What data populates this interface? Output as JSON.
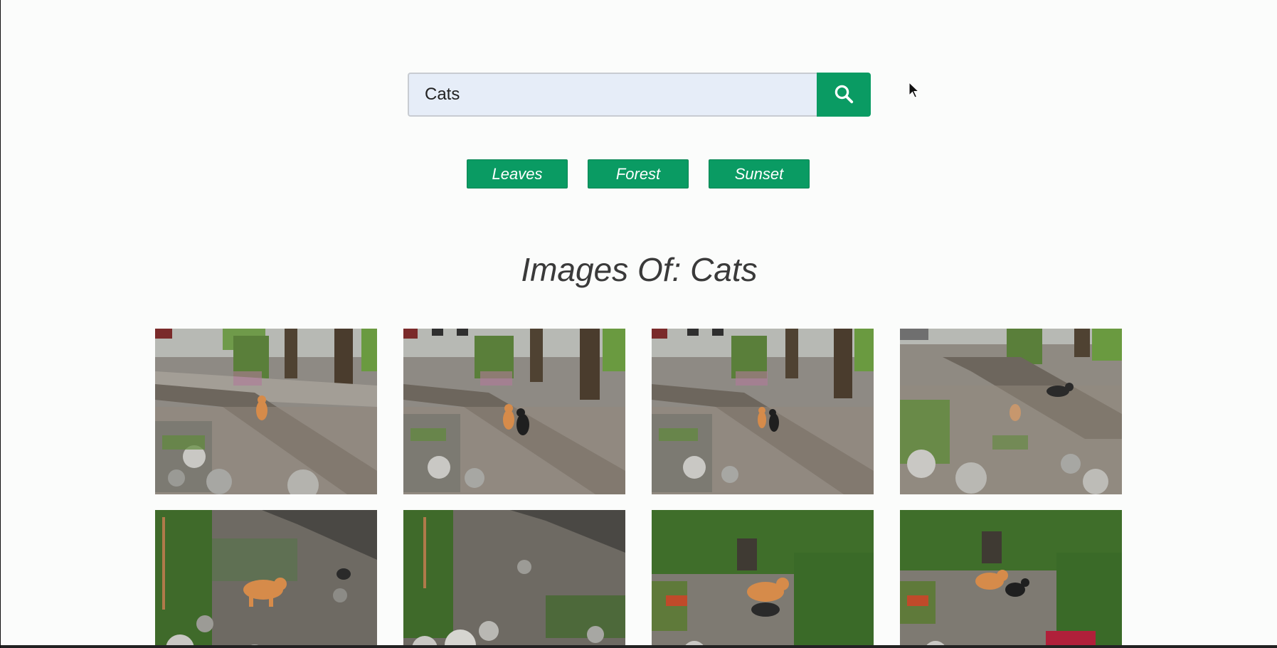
{
  "search": {
    "value": "Cats",
    "button_icon": "search-icon"
  },
  "tags": [
    {
      "label": "Leaves"
    },
    {
      "label": "Forest"
    },
    {
      "label": "Sunset"
    }
  ],
  "results": {
    "title": "Images Of: Cats"
  },
  "colors": {
    "accent": "#0a9b63",
    "input_bg": "#e6edf8",
    "title_text": "#3a3a3a"
  },
  "images": [
    {
      "scene": "walkway-one-orange-cat"
    },
    {
      "scene": "walkway-orange-and-black-cat"
    },
    {
      "scene": "walkway-orange-and-black-cat"
    },
    {
      "scene": "walkway-black-cat-on-path"
    },
    {
      "scene": "rock-garden-orange-cat"
    },
    {
      "scene": "rock-garden-no-cat"
    },
    {
      "scene": "garden-orange-and-dark-cat"
    },
    {
      "scene": "garden-orange-and-black-cat"
    }
  ]
}
